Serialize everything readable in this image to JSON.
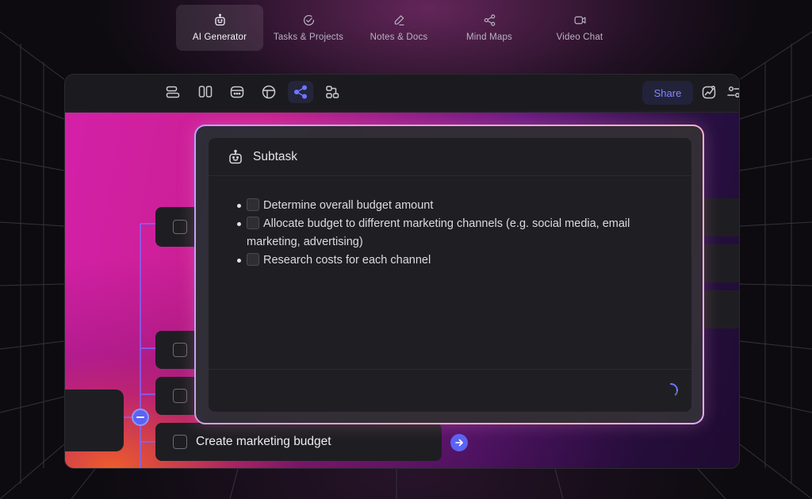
{
  "nav": {
    "tabs": [
      {
        "label": "AI Generator",
        "icon": "robot-icon",
        "active": true
      },
      {
        "label": "Tasks & Projects",
        "icon": "check-circle-icon",
        "active": false
      },
      {
        "label": "Notes & Docs",
        "icon": "pencil-icon",
        "active": false
      },
      {
        "label": "Mind Maps",
        "icon": "share-nodes-icon",
        "active": false
      },
      {
        "label": "Video Chat",
        "icon": "video-camera-icon",
        "active": false
      }
    ]
  },
  "toolbar": {
    "views": [
      "list-view-icon",
      "board-view-icon",
      "calendar-view-icon",
      "table-view-icon",
      "mind-map-view-icon",
      "org-chart-view-icon"
    ],
    "active_view": "mind-map-view-icon",
    "share_label": "Share"
  },
  "mind_map": {
    "focused_node_label": "Create marketing budget"
  },
  "subtask_popup": {
    "title": "Subtask",
    "items": [
      "Determine overall budget amount",
      "Allocate budget to different marketing channels (e.g. social media, email marketing, advertising)",
      "Research costs for each channel"
    ]
  },
  "colors": {
    "accent": "#5b63f3",
    "share_text": "#8088ff",
    "canvas_magenta": "#d420a8",
    "canvas_orange": "#ff6a1e",
    "popup_border": "#f2a7c9"
  }
}
